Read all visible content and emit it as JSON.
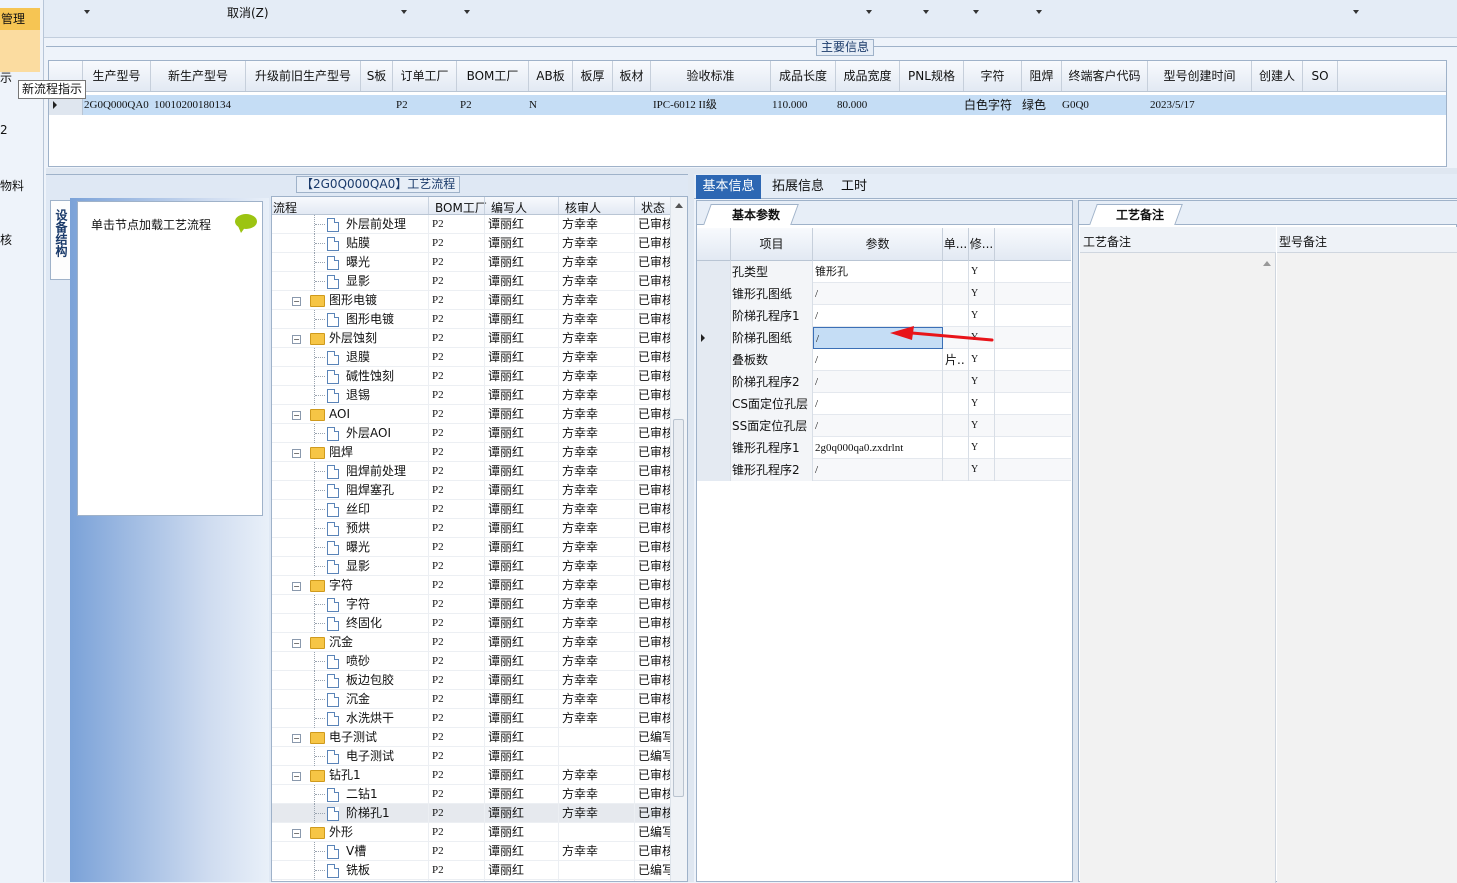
{
  "toolbar": {
    "cancel_label": "取消(Z)"
  },
  "sidebar": {
    "items": [
      "管理",
      "示",
      "2",
      "物料",
      "核"
    ],
    "tooltip": "新流程指示"
  },
  "main_info": {
    "group_title": "主要信息",
    "columns": [
      "生产型号",
      "新生产型号",
      "升级前旧生产型号",
      "S板",
      "订单工厂",
      "BOM工厂",
      "AB板",
      "板厚",
      "板材",
      "验收标准",
      "成品长度",
      "成品宽度",
      "PNL规格",
      "字符",
      "阻焊",
      "终端客户代码",
      "型号创建时间",
      "创建人",
      "SO"
    ],
    "row": [
      "2G0Q000QA0",
      "10010200180134",
      "",
      "",
      "P2",
      "P2",
      "N",
      "",
      "",
      "IPC-6012 II级",
      "110.000",
      "80.000",
      "",
      "白色字符",
      "绿色",
      "G0Q0",
      "2023/5/17",
      "",
      ""
    ]
  },
  "process": {
    "title": "【2G0Q000QA0】工艺流程",
    "side_tab": "设备结构",
    "node_hint": "单击节点加载工艺流程",
    "columns": [
      "流程",
      "BOM工厂",
      "编写人",
      "核审人",
      "状态"
    ],
    "rows": [
      {
        "level": 2,
        "name": "外层前处理",
        "bom": "P2",
        "writer": "谭丽红",
        "reviewer": "方幸幸",
        "status": "已审核"
      },
      {
        "level": 2,
        "name": "贴膜",
        "bom": "P2",
        "writer": "谭丽红",
        "reviewer": "方幸幸",
        "status": "已审核"
      },
      {
        "level": 2,
        "name": "曝光",
        "bom": "P2",
        "writer": "谭丽红",
        "reviewer": "方幸幸",
        "status": "已审核"
      },
      {
        "level": 2,
        "name": "显影",
        "bom": "P2",
        "writer": "谭丽红",
        "reviewer": "方幸幸",
        "status": "已审核"
      },
      {
        "level": 1,
        "name": "图形电镀",
        "bom": "P2",
        "writer": "谭丽红",
        "reviewer": "方幸幸",
        "status": "已审核"
      },
      {
        "level": 2,
        "name": "图形电镀",
        "bom": "P2",
        "writer": "谭丽红",
        "reviewer": "方幸幸",
        "status": "已审核"
      },
      {
        "level": 1,
        "name": "外层蚀刻",
        "bom": "P2",
        "writer": "谭丽红",
        "reviewer": "方幸幸",
        "status": "已审核"
      },
      {
        "level": 2,
        "name": "退膜",
        "bom": "P2",
        "writer": "谭丽红",
        "reviewer": "方幸幸",
        "status": "已审核"
      },
      {
        "level": 2,
        "name": "碱性蚀刻",
        "bom": "P2",
        "writer": "谭丽红",
        "reviewer": "方幸幸",
        "status": "已审核"
      },
      {
        "level": 2,
        "name": "退锡",
        "bom": "P2",
        "writer": "谭丽红",
        "reviewer": "方幸幸",
        "status": "已审核"
      },
      {
        "level": 1,
        "name": "AOI",
        "bom": "P2",
        "writer": "谭丽红",
        "reviewer": "方幸幸",
        "status": "已审核"
      },
      {
        "level": 2,
        "name": "外层AOI",
        "bom": "P2",
        "writer": "谭丽红",
        "reviewer": "方幸幸",
        "status": "已审核"
      },
      {
        "level": 1,
        "name": "阻焊",
        "bom": "P2",
        "writer": "谭丽红",
        "reviewer": "方幸幸",
        "status": "已审核"
      },
      {
        "level": 2,
        "name": "阻焊前处理",
        "bom": "P2",
        "writer": "谭丽红",
        "reviewer": "方幸幸",
        "status": "已审核"
      },
      {
        "level": 2,
        "name": "阻焊塞孔",
        "bom": "P2",
        "writer": "谭丽红",
        "reviewer": "方幸幸",
        "status": "已审核"
      },
      {
        "level": 2,
        "name": "丝印",
        "bom": "P2",
        "writer": "谭丽红",
        "reviewer": "方幸幸",
        "status": "已审核"
      },
      {
        "level": 2,
        "name": "预烘",
        "bom": "P2",
        "writer": "谭丽红",
        "reviewer": "方幸幸",
        "status": "已审核"
      },
      {
        "level": 2,
        "name": "曝光",
        "bom": "P2",
        "writer": "谭丽红",
        "reviewer": "方幸幸",
        "status": "已审核"
      },
      {
        "level": 2,
        "name": "显影",
        "bom": "P2",
        "writer": "谭丽红",
        "reviewer": "方幸幸",
        "status": "已审核"
      },
      {
        "level": 1,
        "name": "字符",
        "bom": "P2",
        "writer": "谭丽红",
        "reviewer": "方幸幸",
        "status": "已审核"
      },
      {
        "level": 2,
        "name": "字符",
        "bom": "P2",
        "writer": "谭丽红",
        "reviewer": "方幸幸",
        "status": "已审核"
      },
      {
        "level": 2,
        "name": "终固化",
        "bom": "P2",
        "writer": "谭丽红",
        "reviewer": "方幸幸",
        "status": "已审核"
      },
      {
        "level": 1,
        "name": "沉金",
        "bom": "P2",
        "writer": "谭丽红",
        "reviewer": "方幸幸",
        "status": "已审核"
      },
      {
        "level": 2,
        "name": "喷砂",
        "bom": "P2",
        "writer": "谭丽红",
        "reviewer": "方幸幸",
        "status": "已审核"
      },
      {
        "level": 2,
        "name": "板边包胶",
        "bom": "P2",
        "writer": "谭丽红",
        "reviewer": "方幸幸",
        "status": "已审核"
      },
      {
        "level": 2,
        "name": "沉金",
        "bom": "P2",
        "writer": "谭丽红",
        "reviewer": "方幸幸",
        "status": "已审核"
      },
      {
        "level": 2,
        "name": "水洗烘干",
        "bom": "P2",
        "writer": "谭丽红",
        "reviewer": "方幸幸",
        "status": "已审核"
      },
      {
        "level": 1,
        "name": "电子测试",
        "bom": "P2",
        "writer": "谭丽红",
        "reviewer": "",
        "status": "已编写"
      },
      {
        "level": 2,
        "name": "电子测试",
        "bom": "P2",
        "writer": "谭丽红",
        "reviewer": "",
        "status": "已编写"
      },
      {
        "level": 1,
        "name": "钻孔1",
        "bom": "P2",
        "writer": "谭丽红",
        "reviewer": "方幸幸",
        "status": "已审核"
      },
      {
        "level": 2,
        "name": "二钻1",
        "bom": "P2",
        "writer": "谭丽红",
        "reviewer": "方幸幸",
        "status": "已审核"
      },
      {
        "level": 2,
        "name": "阶梯孔1",
        "bom": "P2",
        "writer": "谭丽红",
        "reviewer": "方幸幸",
        "status": "已审核",
        "selected": true
      },
      {
        "level": 1,
        "name": "外形",
        "bom": "P2",
        "writer": "谭丽红",
        "reviewer": "",
        "status": "已编写"
      },
      {
        "level": 2,
        "name": "V槽",
        "bom": "P2",
        "writer": "谭丽红",
        "reviewer": "方幸幸",
        "status": "已审核"
      },
      {
        "level": 2,
        "name": "铣板",
        "bom": "P2",
        "writer": "谭丽红",
        "reviewer": "",
        "status": "已编写"
      }
    ]
  },
  "tabs": [
    "基本信息",
    "拓展信息",
    "工时"
  ],
  "params": {
    "subtab": "基本参数",
    "columns": [
      "项目",
      "参数",
      "单...",
      "修..."
    ],
    "rows": [
      {
        "item": "孔类型",
        "param": "锥形孔",
        "unit": "",
        "mod": "Y"
      },
      {
        "item": "锥形孔图纸",
        "param": "/",
        "unit": "",
        "mod": "Y"
      },
      {
        "item": "阶梯孔程序1",
        "param": "/",
        "unit": "",
        "mod": "Y"
      },
      {
        "item": "阶梯孔图纸",
        "param": "/",
        "unit": "",
        "mod": "Y",
        "current": true
      },
      {
        "item": "叠板数",
        "param": "/",
        "unit": "片..",
        "mod": "Y"
      },
      {
        "item": "阶梯孔程序2",
        "param": "/",
        "unit": "",
        "mod": "Y"
      },
      {
        "item": "CS面定位孔层",
        "param": "/",
        "unit": "",
        "mod": "Y"
      },
      {
        "item": "SS面定位孔层",
        "param": "/",
        "unit": "",
        "mod": "Y"
      },
      {
        "item": "锥形孔程序1",
        "param": "2g0q000qa0.zxdrlnt",
        "unit": "",
        "mod": "Y"
      },
      {
        "item": "锥形孔程序2",
        "param": "/",
        "unit": "",
        "mod": "Y"
      }
    ]
  },
  "remarks": {
    "tab": "工艺备注",
    "col1": "工艺备注",
    "col2": "型号备注"
  }
}
